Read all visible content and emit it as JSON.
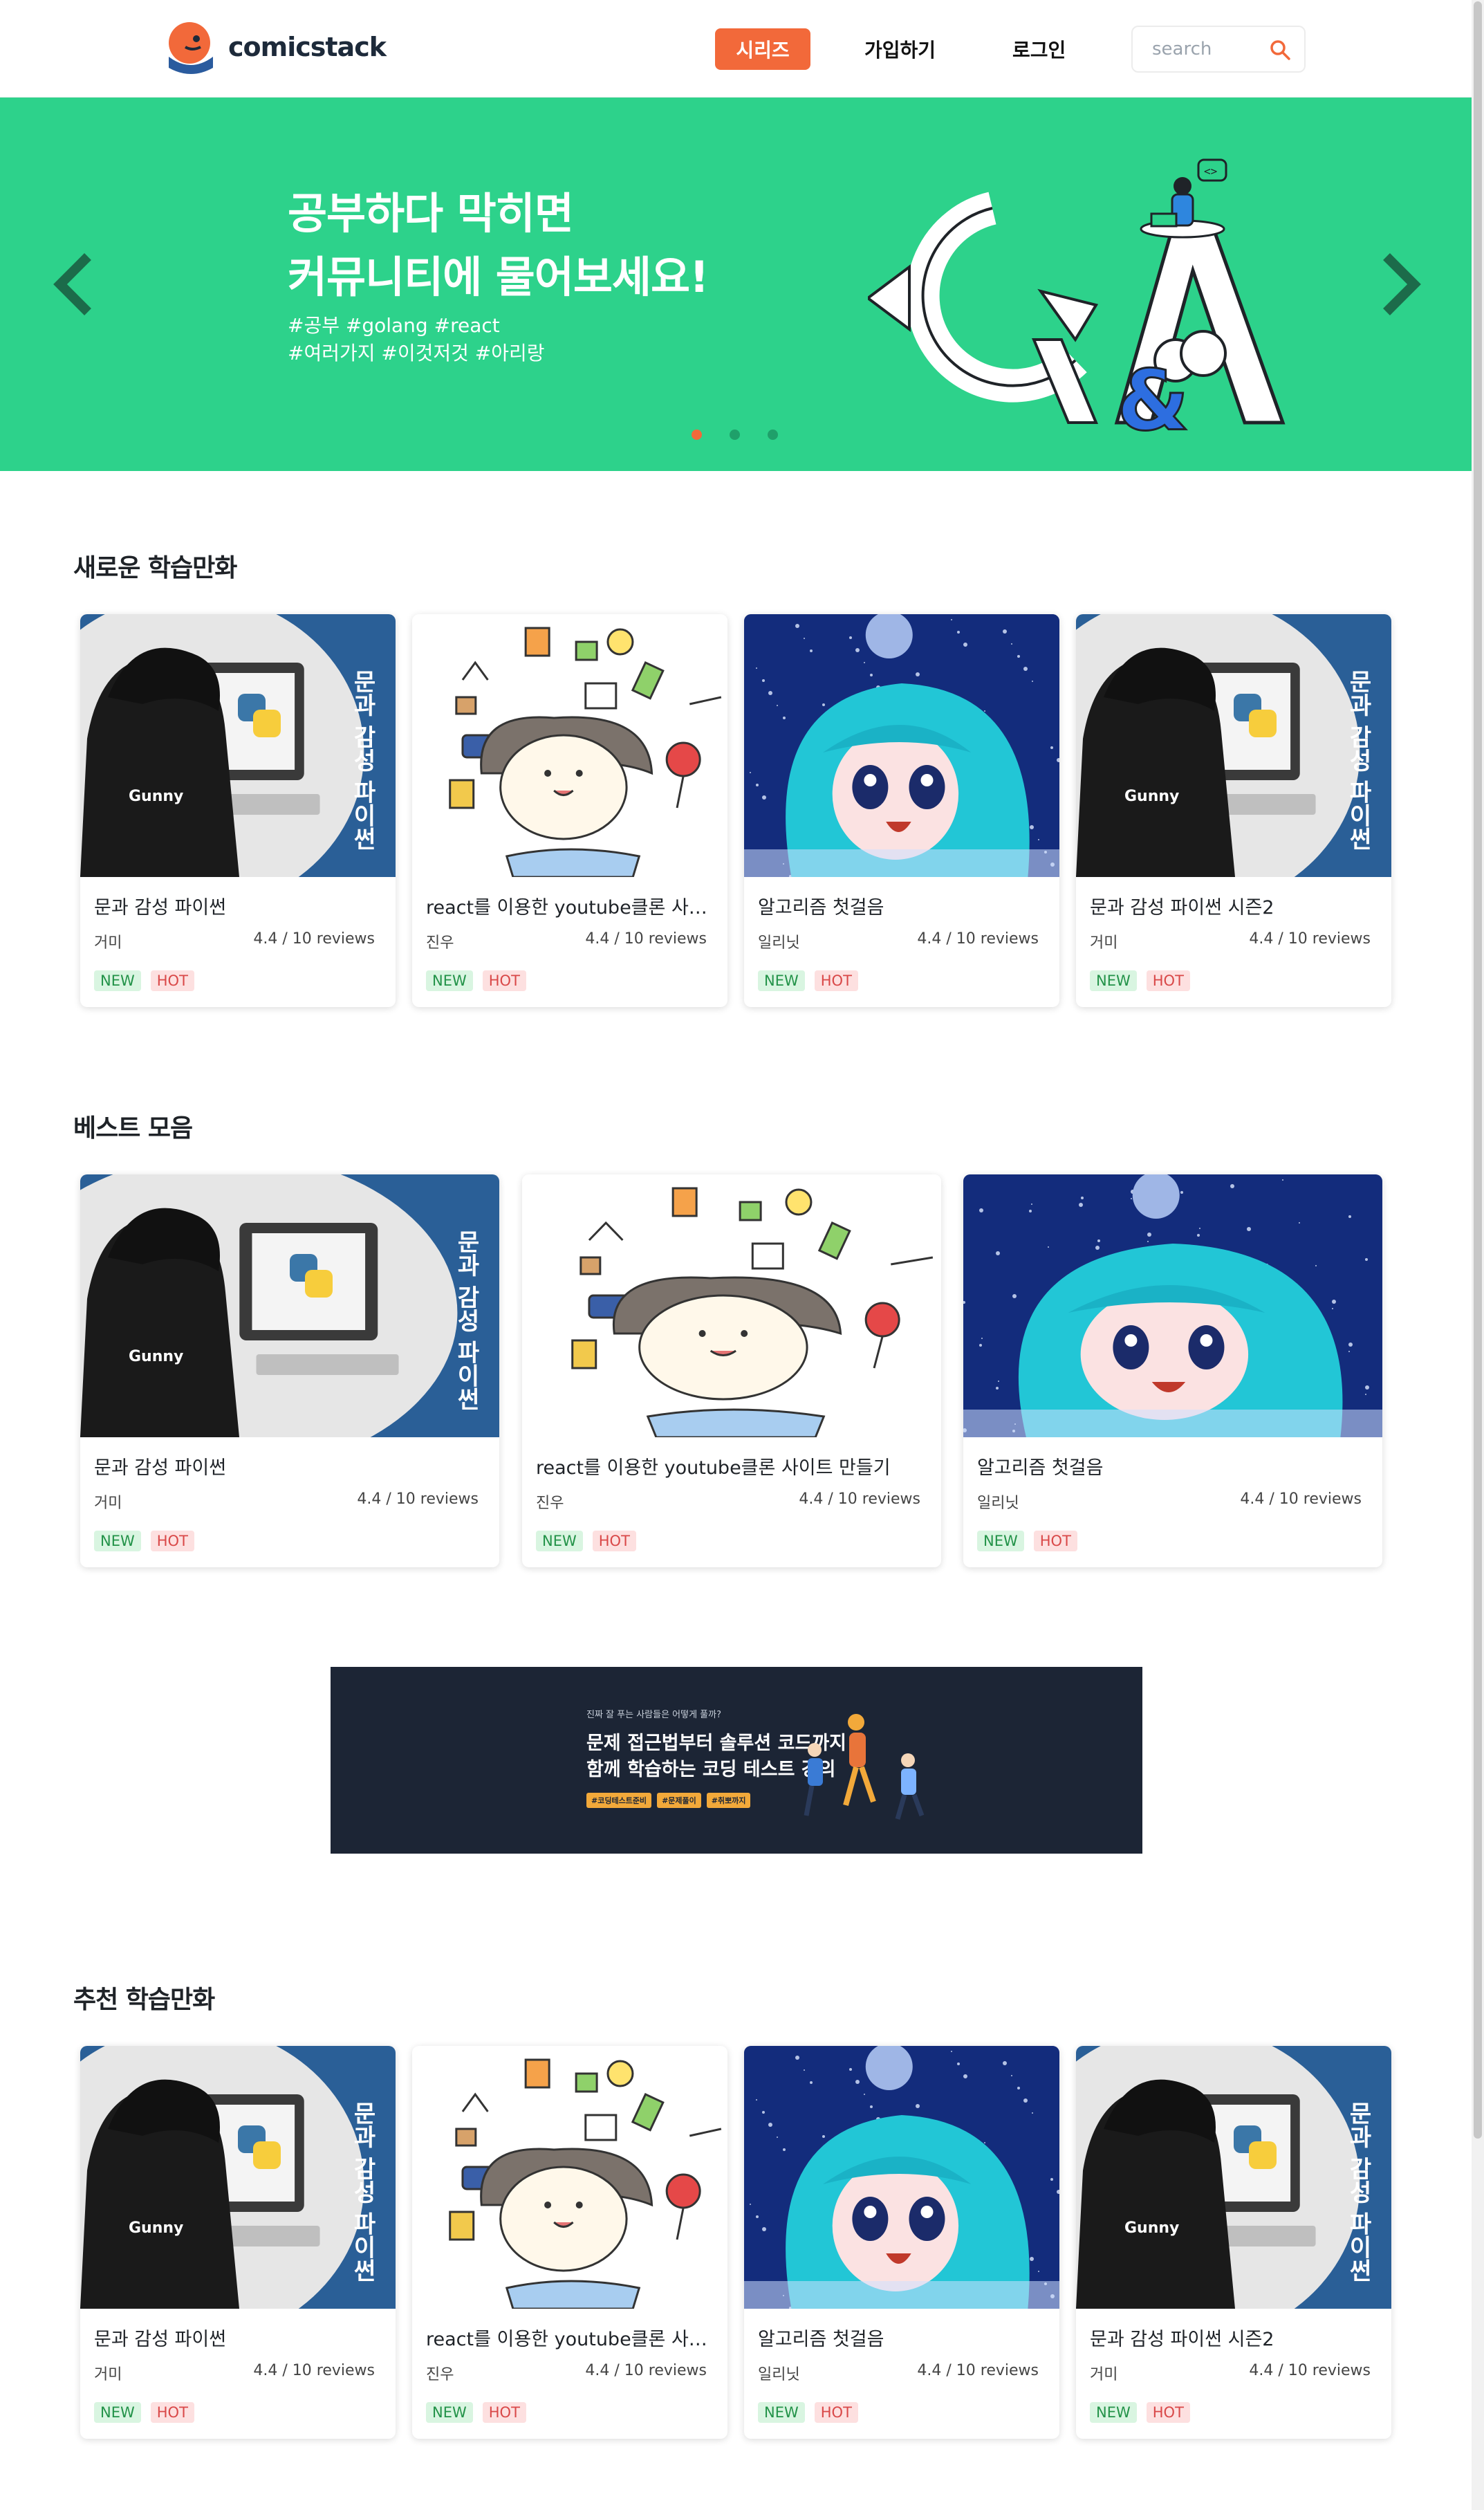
{
  "header": {
    "logo_text": "comicstack",
    "nav_series": "시리즈",
    "nav_join": "가입하기",
    "nav_login": "로그인",
    "search_placeholder": "search"
  },
  "hero": {
    "title_line1": "공부하다 막히면",
    "title_line2": "커뮤니티에 물어보세요!",
    "tags_line1": "#공부 #golang #react",
    "tags_line2": "#여러가지 #이것저것 #아리랑",
    "slides": 3,
    "active_slide": 1
  },
  "colors": {
    "accent": "#f2693a",
    "hero_bg": "#2dd28b",
    "new_badge": "#229248",
    "hot_badge": "#d94848"
  },
  "sections": [
    {
      "title": "새로운 학습만화",
      "cards": [
        {
          "image": "python",
          "title": "문과 감성 파이썬",
          "author": "거미",
          "rating": "4.4 / 10 reviews",
          "badge_new": "NEW",
          "badge_hot": "HOT"
        },
        {
          "image": "doodle",
          "title": "react를 이용한 youtube클론 사이트 만들기",
          "author": "진우",
          "rating": "4.4 / 10 reviews",
          "badge_new": "NEW",
          "badge_hot": "HOT"
        },
        {
          "image": "space",
          "title": "알고리즘 첫걸음",
          "author": "일리닛",
          "rating": "4.4 / 10 reviews",
          "badge_new": "NEW",
          "badge_hot": "HOT"
        },
        {
          "image": "python",
          "title": "문과 감성 파이썬 시즌2",
          "author": "거미",
          "rating": "4.4 / 10 reviews",
          "badge_new": "NEW",
          "badge_hot": "HOT"
        }
      ]
    },
    {
      "title": "베스트 모음",
      "cards": [
        {
          "image": "python",
          "title": "문과 감성 파이썬",
          "author": "거미",
          "rating": "4.4 / 10 reviews",
          "badge_new": "NEW",
          "badge_hot": "HOT"
        },
        {
          "image": "doodle",
          "title": "react를 이용한 youtube클론 사이트 만들기",
          "author": "진우",
          "rating": "4.4 / 10 reviews",
          "badge_new": "NEW",
          "badge_hot": "HOT"
        },
        {
          "image": "space",
          "title": "알고리즘 첫걸음",
          "author": "일리닛",
          "rating": "4.4 / 10 reviews",
          "badge_new": "NEW",
          "badge_hot": "HOT"
        }
      ]
    },
    {
      "title": "추천 학습만화",
      "cards": [
        {
          "image": "python",
          "title": "문과 감성 파이썬",
          "author": "거미",
          "rating": "4.4 / 10 reviews",
          "badge_new": "NEW",
          "badge_hot": "HOT"
        },
        {
          "image": "doodle",
          "title": "react를 이용한 youtube클론 사이트 만들기",
          "author": "진우",
          "rating": "4.4 / 10 reviews",
          "badge_new": "NEW",
          "badge_hot": "HOT"
        },
        {
          "image": "space",
          "title": "알고리즘 첫걸음",
          "author": "일리닛",
          "rating": "4.4 / 10 reviews",
          "badge_new": "NEW",
          "badge_hot": "HOT"
        },
        {
          "image": "python",
          "title": "문과 감성 파이썬 시즌2",
          "author": "거미",
          "rating": "4.4 / 10 reviews",
          "badge_new": "NEW",
          "badge_hot": "HOT"
        }
      ]
    }
  ],
  "ad": {
    "small": "진짜 잘 푸는 사람들은 어떻게 풀까?",
    "line1": "문제 접근법부터 솔루션 코드까지",
    "line2": "함께 학습하는 코딩 테스트 강의",
    "tags": [
      "#코딩테스트준비",
      "#문제풀이",
      "#취뽀까지"
    ]
  },
  "thumb_text": {
    "python_vertical": "문과 감성 파이썬",
    "hoodie": "Gunny"
  }
}
